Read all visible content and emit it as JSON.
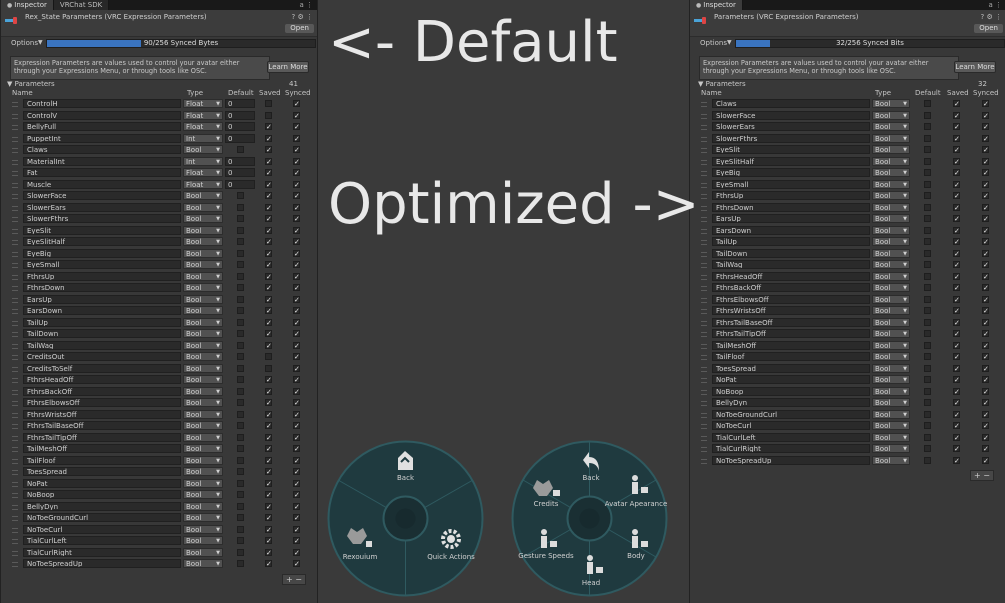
{
  "left": {
    "tabs": [
      "Inspector",
      "VRChat SDK"
    ],
    "tab_tools": "а ⋮",
    "title": "Rex_State Parameters (VRC Expression Parameters)",
    "header_tools": "? ⚙ ⋮",
    "open_label": "Open",
    "options_label": "Options",
    "bytes_text": "90/256 Synced Bytes",
    "bytes_fraction": 0.35,
    "info_text": "Expression Parameters are values used to control your avatar either through your Expressions Menu, or through tools like OSC.",
    "learn_more": "Learn More",
    "parameters_label": "Parameters",
    "count": "41",
    "columns": {
      "name": "Name",
      "type": "Type",
      "default": "Default",
      "saved": "Saved",
      "synced": "Synced"
    },
    "rows": [
      {
        "name": "ControlH",
        "type": "Float",
        "default": "0",
        "saved": false,
        "synced": true
      },
      {
        "name": "ControlV",
        "type": "Float",
        "default": "0",
        "saved": false,
        "synced": true
      },
      {
        "name": "BellyFull",
        "type": "Float",
        "default": "0",
        "saved": true,
        "synced": true
      },
      {
        "name": "PuppetInt",
        "type": "Int",
        "default": "0",
        "saved": true,
        "synced": true
      },
      {
        "name": "Claws",
        "type": "Bool",
        "default": null,
        "saved": true,
        "synced": true
      },
      {
        "name": "MaterialInt",
        "type": "Int",
        "default": "0",
        "saved": true,
        "synced": true
      },
      {
        "name": "Fat",
        "type": "Float",
        "default": "0",
        "saved": true,
        "synced": true
      },
      {
        "name": "Muscle",
        "type": "Float",
        "default": "0",
        "saved": true,
        "synced": true
      },
      {
        "name": "SlowerFace",
        "type": "Bool",
        "default": null,
        "saved": true,
        "synced": true
      },
      {
        "name": "SlowerEars",
        "type": "Bool",
        "default": null,
        "saved": true,
        "synced": true
      },
      {
        "name": "SlowerFthrs",
        "type": "Bool",
        "default": null,
        "saved": true,
        "synced": true
      },
      {
        "name": "EyeSlit",
        "type": "Bool",
        "default": null,
        "saved": true,
        "synced": true
      },
      {
        "name": "EyeSlitHalf",
        "type": "Bool",
        "default": null,
        "saved": true,
        "synced": true
      },
      {
        "name": "EyeBig",
        "type": "Bool",
        "default": null,
        "saved": true,
        "synced": true
      },
      {
        "name": "EyeSmall",
        "type": "Bool",
        "default": null,
        "saved": true,
        "synced": true
      },
      {
        "name": "FthrsUp",
        "type": "Bool",
        "default": null,
        "saved": true,
        "synced": true
      },
      {
        "name": "FthrsDown",
        "type": "Bool",
        "default": null,
        "saved": true,
        "synced": true
      },
      {
        "name": "EarsUp",
        "type": "Bool",
        "default": null,
        "saved": true,
        "synced": true
      },
      {
        "name": "EarsDown",
        "type": "Bool",
        "default": null,
        "saved": true,
        "synced": true
      },
      {
        "name": "TailUp",
        "type": "Bool",
        "default": null,
        "saved": true,
        "synced": true
      },
      {
        "name": "TailDown",
        "type": "Bool",
        "default": null,
        "saved": true,
        "synced": true
      },
      {
        "name": "TailWag",
        "type": "Bool",
        "default": null,
        "saved": true,
        "synced": true
      },
      {
        "name": "CreditsOut",
        "type": "Bool",
        "default": null,
        "saved": false,
        "synced": true
      },
      {
        "name": "CreditsToSelf",
        "type": "Bool",
        "default": null,
        "saved": false,
        "synced": true
      },
      {
        "name": "FthrsHeadOff",
        "type": "Bool",
        "default": null,
        "saved": true,
        "synced": true
      },
      {
        "name": "FthrsBackOff",
        "type": "Bool",
        "default": null,
        "saved": true,
        "synced": true
      },
      {
        "name": "FthrsElbowsOff",
        "type": "Bool",
        "default": null,
        "saved": true,
        "synced": true
      },
      {
        "name": "FthrsWristsOff",
        "type": "Bool",
        "default": null,
        "saved": true,
        "synced": true
      },
      {
        "name": "FthrsTailBaseOff",
        "type": "Bool",
        "default": null,
        "saved": true,
        "synced": true
      },
      {
        "name": "FthrsTailTipOff",
        "type": "Bool",
        "default": null,
        "saved": true,
        "synced": true
      },
      {
        "name": "TailMeshOff",
        "type": "Bool",
        "default": null,
        "saved": true,
        "synced": true
      },
      {
        "name": "TailFloof",
        "type": "Bool",
        "default": null,
        "saved": true,
        "synced": true
      },
      {
        "name": "ToesSpread",
        "type": "Bool",
        "default": null,
        "saved": true,
        "synced": true
      },
      {
        "name": "NoPat",
        "type": "Bool",
        "default": null,
        "saved": true,
        "synced": true
      },
      {
        "name": "NoBoop",
        "type": "Bool",
        "default": null,
        "saved": true,
        "synced": true
      },
      {
        "name": "BellyDyn",
        "type": "Bool",
        "default": null,
        "saved": true,
        "synced": true
      },
      {
        "name": "NoToeGroundCurl",
        "type": "Bool",
        "default": null,
        "saved": true,
        "synced": true
      },
      {
        "name": "NoToeCurl",
        "type": "Bool",
        "default": null,
        "saved": true,
        "synced": true
      },
      {
        "name": "TialCurlLeft",
        "type": "Bool",
        "default": null,
        "saved": true,
        "synced": true
      },
      {
        "name": "TialCurlRight",
        "type": "Bool",
        "default": null,
        "saved": true,
        "synced": true
      },
      {
        "name": "NoToeSpreadUp",
        "type": "Bool",
        "default": null,
        "saved": true,
        "synced": true
      }
    ],
    "add": "+",
    "remove": "−"
  },
  "right": {
    "tabs": [
      "Inspector"
    ],
    "tab_tools": "а ⋮",
    "title": "Parameters (VRC Expression Parameters)",
    "header_tools": "? ⚙ ⋮",
    "open_label": "Open",
    "options_label": "Options",
    "bytes_text": "32/256 Synced Bits",
    "bytes_fraction": 0.125,
    "info_text": "Expression Parameters are values used to control your avatar either through your Expressions Menu, or through tools like OSC.",
    "learn_more": "Learn More",
    "parameters_label": "Parameters",
    "count": "32",
    "columns": {
      "name": "Name",
      "type": "Type",
      "default": "Default",
      "saved": "Saved",
      "synced": "Synced"
    },
    "rows": [
      {
        "name": "Claws",
        "type": "Bool",
        "default": null,
        "saved": true,
        "synced": true
      },
      {
        "name": "SlowerFace",
        "type": "Bool",
        "default": null,
        "saved": true,
        "synced": true
      },
      {
        "name": "SlowerEars",
        "type": "Bool",
        "default": null,
        "saved": true,
        "synced": true
      },
      {
        "name": "SlowerFthrs",
        "type": "Bool",
        "default": null,
        "saved": true,
        "synced": true
      },
      {
        "name": "EyeSlit",
        "type": "Bool",
        "default": null,
        "saved": true,
        "synced": true
      },
      {
        "name": "EyeSlitHalf",
        "type": "Bool",
        "default": null,
        "saved": true,
        "synced": true
      },
      {
        "name": "EyeBig",
        "type": "Bool",
        "default": null,
        "saved": true,
        "synced": true
      },
      {
        "name": "EyeSmall",
        "type": "Bool",
        "default": null,
        "saved": true,
        "synced": true
      },
      {
        "name": "FthrsUp",
        "type": "Bool",
        "default": null,
        "saved": true,
        "synced": true
      },
      {
        "name": "FthrsDown",
        "type": "Bool",
        "default": null,
        "saved": true,
        "synced": true
      },
      {
        "name": "EarsUp",
        "type": "Bool",
        "default": null,
        "saved": true,
        "synced": true
      },
      {
        "name": "EarsDown",
        "type": "Bool",
        "default": null,
        "saved": true,
        "synced": true
      },
      {
        "name": "TailUp",
        "type": "Bool",
        "default": null,
        "saved": true,
        "synced": true
      },
      {
        "name": "TailDown",
        "type": "Bool",
        "default": null,
        "saved": true,
        "synced": true
      },
      {
        "name": "TailWag",
        "type": "Bool",
        "default": null,
        "saved": true,
        "synced": true
      },
      {
        "name": "FthrsHeadOff",
        "type": "Bool",
        "default": null,
        "saved": true,
        "synced": true
      },
      {
        "name": "FthrsBackOff",
        "type": "Bool",
        "default": null,
        "saved": true,
        "synced": true
      },
      {
        "name": "FthrsElbowsOff",
        "type": "Bool",
        "default": null,
        "saved": true,
        "synced": true
      },
      {
        "name": "FthrsWristsOff",
        "type": "Bool",
        "default": null,
        "saved": true,
        "synced": true
      },
      {
        "name": "FthrsTailBaseOff",
        "type": "Bool",
        "default": null,
        "saved": true,
        "synced": true
      },
      {
        "name": "FthrsTailTipOff",
        "type": "Bool",
        "default": null,
        "saved": true,
        "synced": true
      },
      {
        "name": "TailMeshOff",
        "type": "Bool",
        "default": null,
        "saved": true,
        "synced": true
      },
      {
        "name": "TailFloof",
        "type": "Bool",
        "default": null,
        "saved": true,
        "synced": true
      },
      {
        "name": "ToesSpread",
        "type": "Bool",
        "default": null,
        "saved": true,
        "synced": true
      },
      {
        "name": "NoPat",
        "type": "Bool",
        "default": null,
        "saved": true,
        "synced": true
      },
      {
        "name": "NoBoop",
        "type": "Bool",
        "default": null,
        "saved": true,
        "synced": true
      },
      {
        "name": "BellyDyn",
        "type": "Bool",
        "default": null,
        "saved": true,
        "synced": true
      },
      {
        "name": "NoToeGroundCurl",
        "type": "Bool",
        "default": null,
        "saved": true,
        "synced": true
      },
      {
        "name": "NoToeCurl",
        "type": "Bool",
        "default": null,
        "saved": true,
        "synced": true
      },
      {
        "name": "TialCurlLeft",
        "type": "Bool",
        "default": null,
        "saved": true,
        "synced": true
      },
      {
        "name": "TialCurlRight",
        "type": "Bool",
        "default": null,
        "saved": true,
        "synced": true
      },
      {
        "name": "NoToeSpreadUp",
        "type": "Bool",
        "default": null,
        "saved": true,
        "synced": true
      }
    ],
    "add": "+",
    "remove": "−"
  },
  "overlay": {
    "default_label": "<- Default",
    "optimized_label": "Optimized ->"
  },
  "menu_default": {
    "items": [
      {
        "label": "Back",
        "icon": "back-icon"
      },
      {
        "label": "Quick Actions",
        "icon": "gear-icon"
      },
      {
        "label": "Rexouium",
        "icon": "avatar-icon"
      }
    ]
  },
  "menu_optimized": {
    "items": [
      {
        "label": "Back",
        "icon": "back-icon"
      },
      {
        "label": "Avatar Apearance",
        "icon": "person-icon"
      },
      {
        "label": "Body",
        "icon": "person-icon"
      },
      {
        "label": "Head",
        "icon": "person-icon"
      },
      {
        "label": "Gesture Speeds",
        "icon": "person-icon"
      },
      {
        "label": "Credits",
        "icon": "avatar-icon"
      }
    ]
  },
  "colors": {
    "accent": "#3a74c0",
    "panel": "#383838",
    "background": "#3a3a3a",
    "menu_fill": "#1f3a3f",
    "menu_ring": "#2f5a60"
  }
}
